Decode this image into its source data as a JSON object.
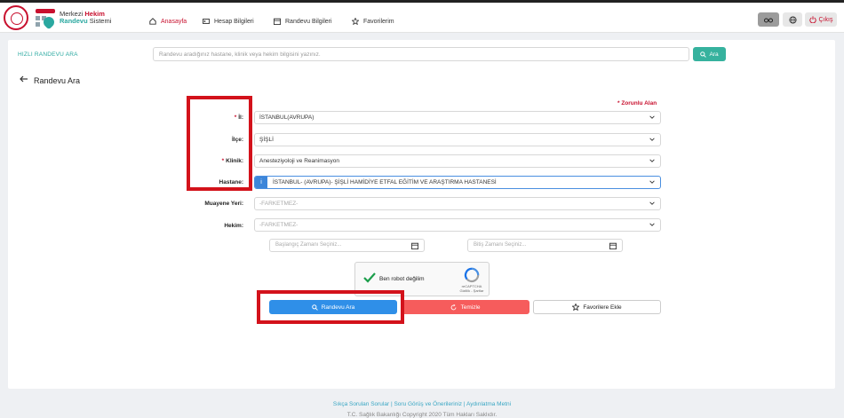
{
  "header": {
    "brand_line1_prefix": "Merkezi",
    "brand_line1_suffix": "Hekim",
    "brand_line2_prefix": "Randevu",
    "brand_line2_suffix": "Sistemi",
    "nav": [
      {
        "label": "Anasayfa",
        "icon": "home-icon"
      },
      {
        "label": "Hesap Bilgileri",
        "icon": "id-card-icon"
      },
      {
        "label": "Randevu Bilgileri",
        "icon": "calendar-icon"
      },
      {
        "label": "Favorilerim",
        "icon": "star-icon"
      }
    ],
    "logout_label": "Çıkış"
  },
  "quick": {
    "label": "HIZLI RANDEVU ARA",
    "placeholder": "Randevu aradığınız hastane, klinik veya hekim bilgisini yazınız.",
    "button": "Ara"
  },
  "page": {
    "title": "Randevu Ara",
    "required_note": "* Zorunlu Alan"
  },
  "form": {
    "il": {
      "label": "İl:",
      "value": "İSTANBUL(AVRUPA)"
    },
    "ilce": {
      "label": "İlçe:",
      "value": "ŞİŞLİ"
    },
    "klinik": {
      "label": "Klinik:",
      "value": "Anesteziyoloji ve Reanimasyon"
    },
    "hastane": {
      "label": "Hastane:",
      "value": "İSTANBUL- (AVRUPA)- ŞİŞLİ HAMİDİYE ETFAL EĞİTİM VE ARAŞTIRMA HASTANESİ"
    },
    "muayene": {
      "label": "Muayene Yeri:",
      "value": "-FARKETMEZ-"
    },
    "hekim": {
      "label": "Hekim:",
      "value": "-FARKETMEZ-"
    },
    "start_date_placeholder": "Başlangıç Zamanı Seçiniz...",
    "end_date_placeholder": "Bitiş Zamanı Seçiniz..."
  },
  "captcha": {
    "label": "Ben robot değilim",
    "brand": "reCAPTCHA",
    "links": "Gizlilik - Şartlar"
  },
  "actions": {
    "search": "Randevu Ara",
    "clear": "Temizle",
    "favorite": "Favorilere Ekle"
  },
  "footer": {
    "links": "Sıkça Sorulan Sorular | Soru Görüş ve Önerileriniz | Aydınlatma Metni",
    "copyright": "T.C. Sağlık Bakanlığı Copyright 2020 Tüm Hakları Saklıdır."
  },
  "colors": {
    "brand_red": "#c8102e",
    "teal": "#2aa8a0",
    "primary_blue": "#2f8fe8",
    "danger_red": "#f65c5c",
    "annotation_red": "#d3121b"
  }
}
